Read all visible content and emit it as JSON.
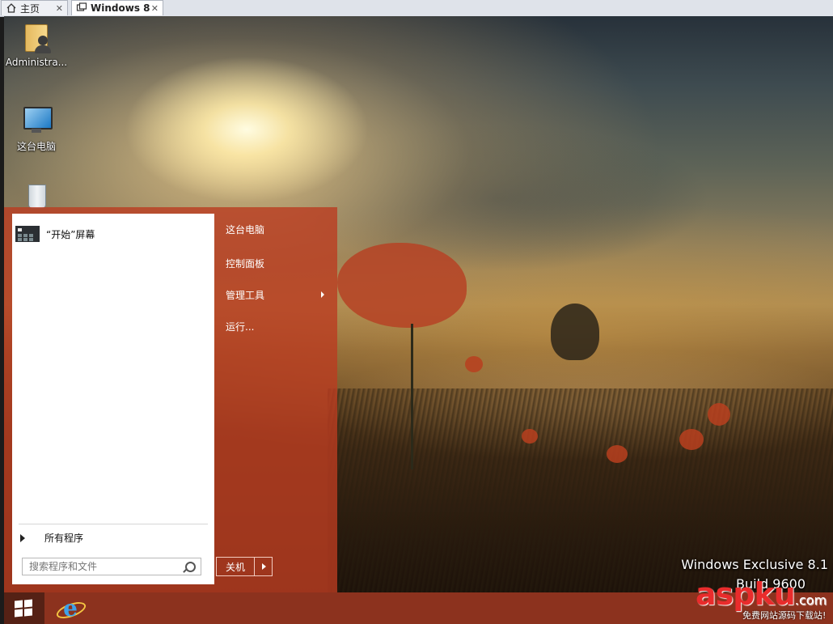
{
  "tabs": [
    {
      "label": "主页",
      "icon": "home-icon"
    },
    {
      "label": "Windows 8",
      "icon": "vm-icon"
    }
  ],
  "tab_close": "✕",
  "desktop_icons": [
    {
      "label": "Administra...",
      "icon": "user-folder-icon"
    },
    {
      "label": "这台电脑",
      "icon": "computer-icon"
    },
    {
      "label": "",
      "icon": "recycle-bin-icon"
    }
  ],
  "start_menu": {
    "pinned": [
      {
        "label": "“开始”屏幕",
        "icon": "start-screen-icon"
      }
    ],
    "all_programs": "所有程序",
    "search_placeholder": "搜索程序和文件",
    "right_links": [
      {
        "label": "这台电脑"
      },
      {
        "label": "控制面板"
      },
      {
        "label": "管理工具",
        "has_submenu": true
      },
      {
        "label": "运行..."
      }
    ],
    "shutdown_label": "关机"
  },
  "watermark": {
    "line1": "Windows Exclusive 8.1",
    "line2": "Build 9600",
    "brand": "aspku",
    "brand_suffix": ".com",
    "brand_sub": "免费网站源码下载站!"
  },
  "taskbar": {
    "pinned": [
      {
        "icon": "internet-explorer-icon"
      }
    ]
  },
  "colors": {
    "start_menu_accent": "#b83c20",
    "taskbar": "#96341e"
  }
}
